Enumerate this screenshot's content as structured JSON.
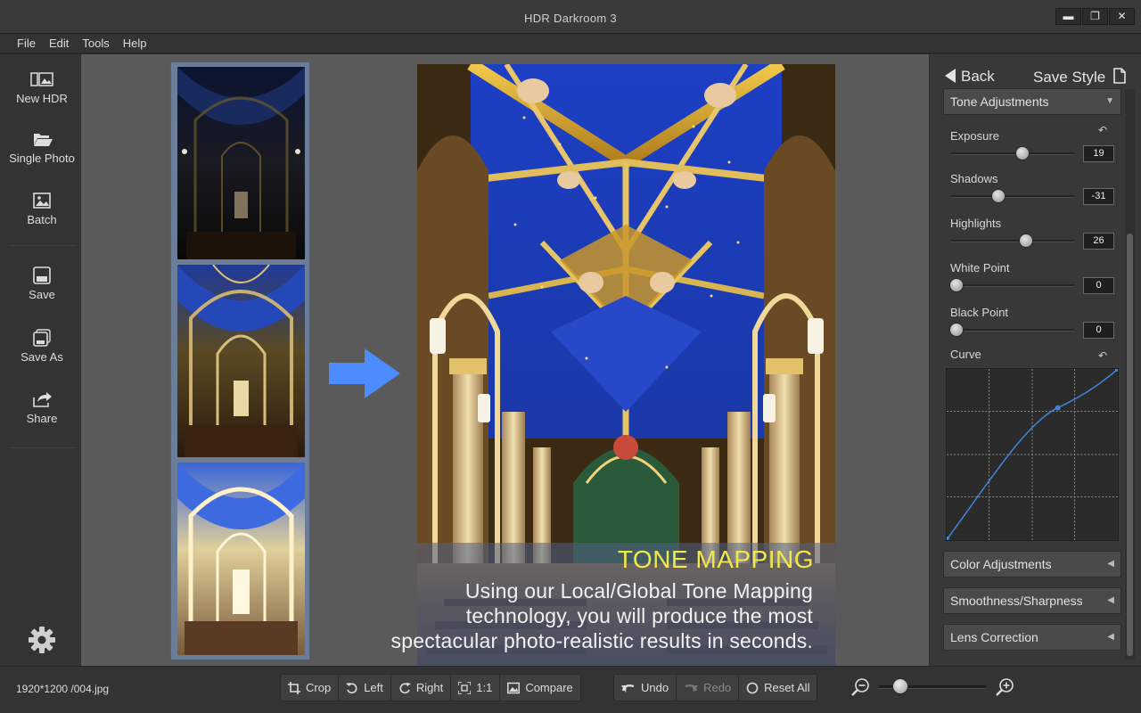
{
  "app": {
    "title": "HDR Darkroom 3"
  },
  "window_buttons": {
    "minimize": "▬",
    "restore": "❐",
    "close": "✕"
  },
  "menu": [
    "File",
    "Edit",
    "Tools",
    "Help"
  ],
  "left_tools": {
    "new_hdr": "New HDR",
    "single_photo": "Single Photo",
    "batch": "Batch",
    "save": "Save",
    "save_as": "Save As",
    "share": "Share"
  },
  "caption": {
    "title": "TONE MAPPING",
    "line1": "Using our Local/Global Tone Mapping",
    "line2": "technology, you will produce the most",
    "line3": "spectacular photo-realistic results in seconds."
  },
  "right_panel": {
    "back": "Back",
    "save_style": "Save Style",
    "tone_section": "Tone Adjustments",
    "adjustments": [
      {
        "label": "Exposure",
        "value": "19",
        "level": 0.57
      },
      {
        "label": "Shadows",
        "value": "-31",
        "level": 0.36
      },
      {
        "label": "Highlights",
        "value": "26",
        "level": 0.6
      },
      {
        "label": "White Point",
        "value": "0",
        "level": 0.0
      },
      {
        "label": "Black Point",
        "value": "0",
        "level": 0.0
      }
    ],
    "curve_label": "Curve",
    "sections": [
      "Color Adjustments",
      "Smoothness/Sharpness",
      "Lens Correction"
    ]
  },
  "status": {
    "file_info": "1920*1200 /004.jpg"
  },
  "bottom_tools": {
    "crop": "Crop",
    "left": "Left",
    "right": "Right",
    "one_to_one": "1:1",
    "compare": "Compare",
    "undo": "Undo",
    "redo": "Redo",
    "reset_all": "Reset All"
  },
  "zoom": {
    "level": 0.2
  },
  "colors": {
    "accent_blue": "#4d8cff",
    "caption_yellow": "#f3e84a"
  }
}
